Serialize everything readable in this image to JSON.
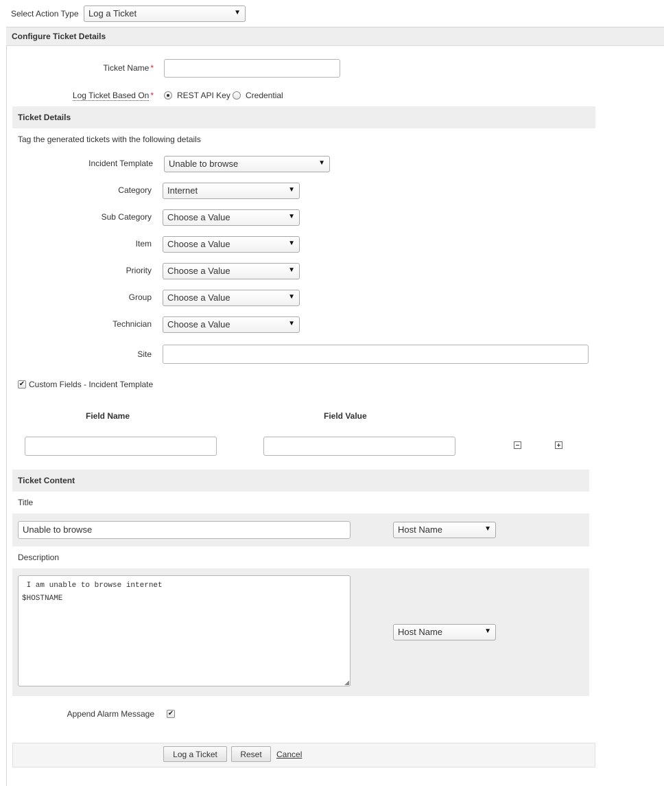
{
  "action_type": {
    "label": "Select Action Type",
    "value": "Log a Ticket"
  },
  "configure": {
    "title": "Configure Ticket Details",
    "ticket_name_label": "Ticket Name",
    "ticket_name_value": "",
    "based_on_label": "Log Ticket Based On",
    "based_on_options": [
      "REST API Key",
      "Credential"
    ],
    "based_on_selected": "REST API Key"
  },
  "ticket_details": {
    "title": "Ticket Details",
    "description": "Tag the generated tickets with the following details",
    "incident_template": {
      "label": "Incident Template",
      "value": "Unable to browse"
    },
    "category": {
      "label": "Category",
      "value": "Internet"
    },
    "sub_category": {
      "label": "Sub Category",
      "value": "Choose a Value"
    },
    "item": {
      "label": "Item",
      "value": "Choose a Value"
    },
    "priority": {
      "label": "Priority",
      "value": "Choose a Value"
    },
    "group": {
      "label": "Group",
      "value": "Choose a Value"
    },
    "technician": {
      "label": "Technician",
      "value": "Choose a Value"
    },
    "site": {
      "label": "Site",
      "value": ""
    }
  },
  "custom_fields": {
    "label": "Custom Fields - Incident Template",
    "checked": true,
    "field_name_header": "Field Name",
    "field_value_header": "Field Value",
    "rows": [
      {
        "name": "",
        "value": ""
      }
    ]
  },
  "ticket_content": {
    "title": "Ticket Content",
    "title_label": "Title",
    "title_value": "Unable to browse",
    "title_var": "Host Name",
    "description_label": "Description",
    "description_line1": " I am unable to browse internet",
    "description_line2": "$HOSTNAME",
    "description_var": "Host Name",
    "append_label": "Append Alarm Message",
    "append_checked": true
  },
  "actions": {
    "submit": "Log a Ticket",
    "reset": "Reset",
    "cancel": "Cancel"
  },
  "colors": {
    "required": "#d9272e",
    "section_bg": "#eeeeee",
    "link": "#333333"
  }
}
